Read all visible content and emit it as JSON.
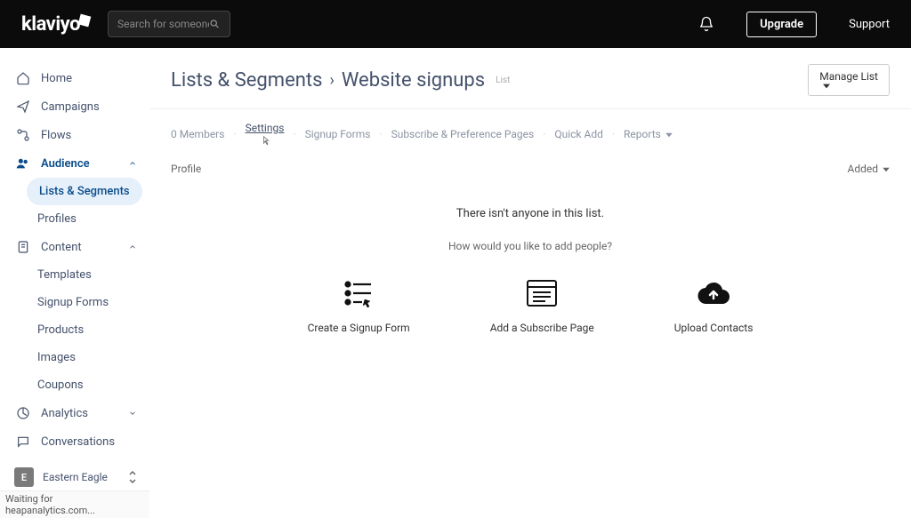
{
  "topbar": {
    "logo": "klaviyo",
    "search_placeholder": "Search for someone...",
    "upgrade": "Upgrade",
    "support": "Support"
  },
  "sidebar": {
    "home": "Home",
    "campaigns": "Campaigns",
    "flows": "Flows",
    "audience": "Audience",
    "lists_segments": "Lists & Segments",
    "profiles": "Profiles",
    "content": "Content",
    "templates": "Templates",
    "signup_forms": "Signup Forms",
    "products": "Products",
    "images": "Images",
    "coupons": "Coupons",
    "analytics": "Analytics",
    "conversations": "Conversations"
  },
  "account": {
    "initial": "E",
    "name": "Eastern Eagle"
  },
  "statusbar": "Waiting for heapanalytics.com...",
  "breadcrumb": {
    "parent": "Lists & Segments",
    "current": "Website signups",
    "tag": "List"
  },
  "manage_list": "Manage List",
  "tabs": {
    "members": "0 Members",
    "settings": "Settings",
    "signup_forms": "Signup Forms",
    "subscribe_pages": "Subscribe & Preference Pages",
    "quick_add": "Quick Add",
    "reports": "Reports"
  },
  "columns": {
    "profile": "Profile",
    "added": "Added"
  },
  "empty": {
    "line1": "There isn't anyone in this list.",
    "line2": "How would you like to add people?",
    "create_form": "Create a Signup Form",
    "add_page": "Add a Subscribe Page",
    "upload": "Upload Contacts"
  }
}
